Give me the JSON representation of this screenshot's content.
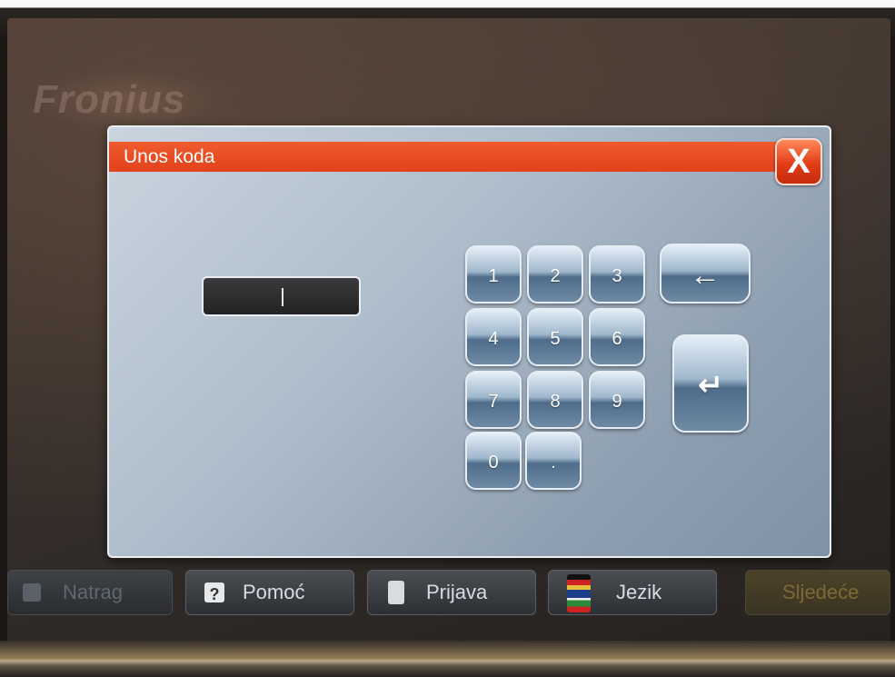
{
  "brand": "Fronius",
  "dialog": {
    "title": "Unos koda",
    "close_label": "X",
    "code_value": ""
  },
  "keypad": {
    "keys": [
      "1",
      "2",
      "3",
      "4",
      "5",
      "6",
      "7",
      "8",
      "9",
      "0",
      "."
    ],
    "backspace_glyph": "←",
    "enter_glyph": "↵"
  },
  "nav": {
    "back": "Natrag",
    "help": "Pomoć",
    "help_icon": "?",
    "login": "Prijava",
    "language": "Jezik",
    "next": "Sljedeće"
  },
  "icons": {
    "close": "close-icon",
    "backspace": "backspace-icon",
    "enter": "enter-icon",
    "help": "help-icon",
    "login": "key-icon",
    "language": "flags-icon",
    "back": "home-icon"
  },
  "colors": {
    "titlebar": "#e9481f",
    "dialog_bg": "#a9b8c7",
    "accent_close": "#e23d16"
  }
}
